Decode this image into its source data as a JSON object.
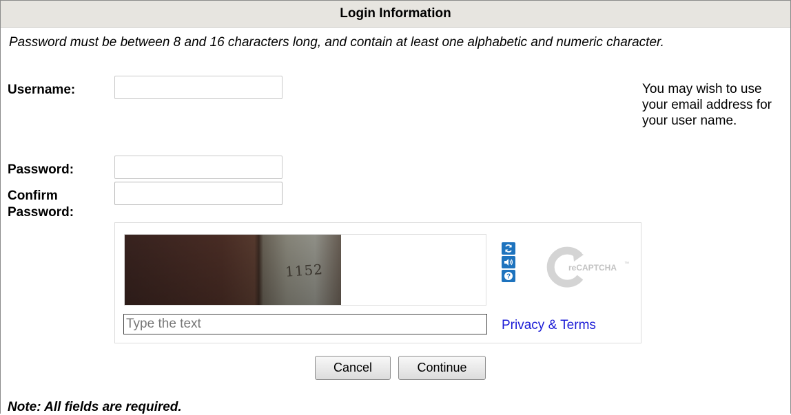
{
  "header": {
    "title": "Login Information"
  },
  "hint": "Password must be between 8 and 16 characters long, and contain at least one alphabetic and numeric character.",
  "username": {
    "label": "Username:",
    "value": ""
  },
  "password": {
    "label": "Password:",
    "value": ""
  },
  "confirm": {
    "label_line1": "Confirm",
    "label_line2": "Password:",
    "value": ""
  },
  "side_note": "You may wish to use your email address for your user name.",
  "captcha": {
    "image_text": "1152",
    "input_placeholder": "Type the text",
    "privacy_link": "Privacy & Terms",
    "logo_text": "reCAPTCHA",
    "logo_tm": "™",
    "icons": [
      "refresh-icon",
      "audio-icon",
      "help-icon"
    ]
  },
  "buttons": {
    "cancel": "Cancel",
    "continue": "Continue"
  },
  "note": "Note: All fields are required."
}
